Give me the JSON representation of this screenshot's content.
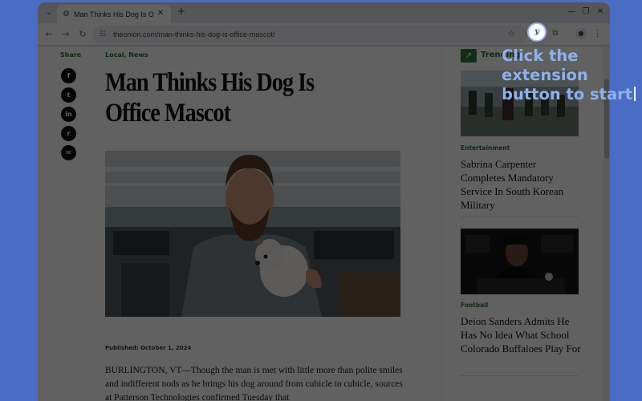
{
  "browser": {
    "tab_title": "Man Thinks His Dog Is Office",
    "tab_favicon": "onion-favicon",
    "url": "theonion.com/man-thinks-his-dog-is-office-mascot/"
  },
  "icons": {
    "tab_menu": "chevron-down-icon",
    "close": "close-icon",
    "new_tab": "plus-icon",
    "back": "arrow-left-icon",
    "forward": "arrow-right-icon",
    "reload": "reload-icon",
    "site_info": "tune-icon",
    "bookmark": "star-icon",
    "extension": "extension-logo-icon",
    "extensions": "puzzle-icon",
    "profile": "person-icon",
    "menu": "kebab-icon",
    "trending": "trending-up-icon"
  },
  "share": {
    "label": "Share",
    "buttons": [
      {
        "name": "facebook",
        "glyph": "f"
      },
      {
        "name": "twitter",
        "glyph": "t"
      },
      {
        "name": "linkedin",
        "glyph": "in"
      },
      {
        "name": "reddit",
        "glyph": "r"
      },
      {
        "name": "email",
        "glyph": "✉"
      }
    ]
  },
  "article": {
    "section": "Local, News",
    "headline": "Man Thinks His Dog Is Office Mascot",
    "published": "Published: October 1, 2024",
    "body": "BURLINGTON, VT—Though the man is met with little more than polite smiles and indifferent nods as he brings his dog around from cubicle to cubicle, sources at Patterson Technologies confirmed Tuesday that"
  },
  "sidebar": {
    "trending_label": "Trending",
    "cards": [
      {
        "category": "Entertainment",
        "title": "Sabrina Carpenter Completes Mandatory Service In South Korean Military"
      },
      {
        "category": "Football",
        "title": "Deion Sanders Admits He Has No Idea What School Colorado Buffaloes Play For"
      }
    ]
  },
  "overlay": {
    "hint_text": "Click the extension button to start"
  },
  "colors": {
    "desktop": "#4a6cc4",
    "accent_green": "#2e6e3a",
    "hint": "#8fb1ea"
  }
}
